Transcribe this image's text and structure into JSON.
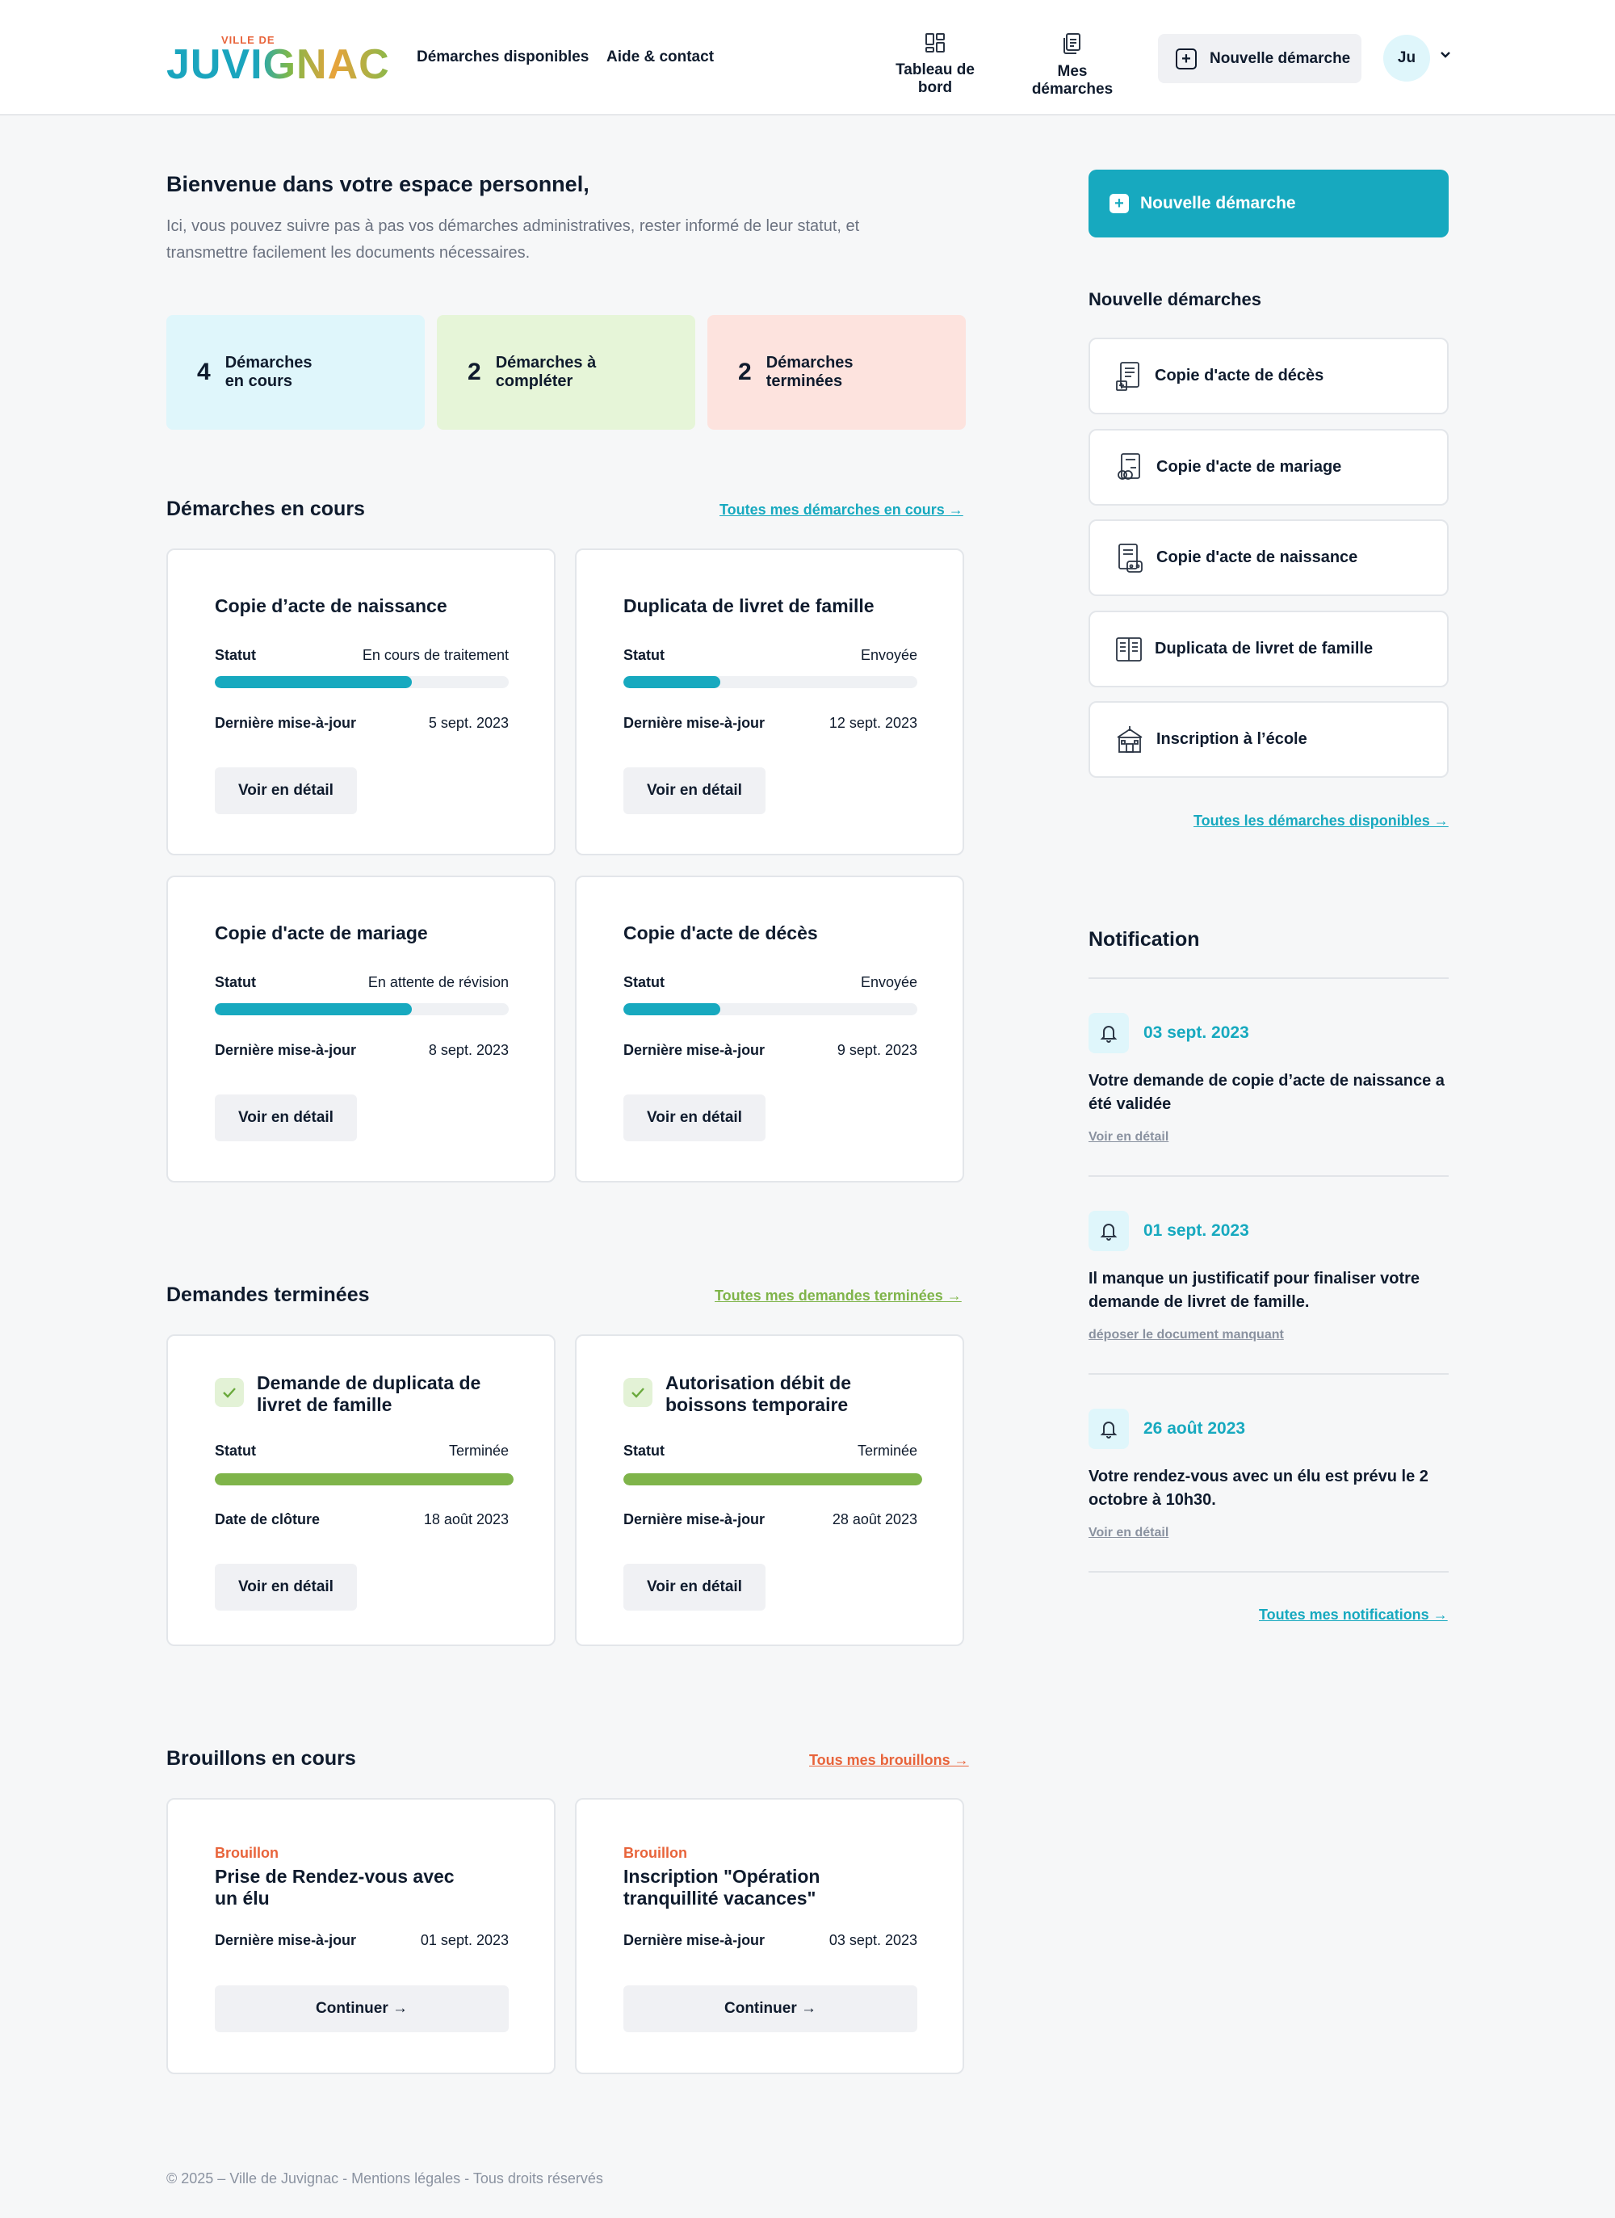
{
  "header": {
    "logo_small": "VILLE DE",
    "logo_big": "JUVIGNAC",
    "nav": [
      "Démarches disponibles",
      "Aide & contact"
    ],
    "dashboard_label": "Tableau de bord",
    "my_procedures_label": "Mes démarches",
    "new_procedure_label": "Nouvelle démarche",
    "avatar_initials": "Ju"
  },
  "welcome": {
    "title": "Bienvenue dans votre espace personnel,",
    "text": "Ici, vous pouvez suivre pas à pas vos démarches administratives, rester informé de leur statut, et transmettre facilement les documents nécessaires."
  },
  "stats": [
    {
      "value": "4",
      "label_line1": "Démarches",
      "label_line2": "en cours",
      "color": "#dff6fb"
    },
    {
      "value": "2",
      "label_line1": "Démarches à",
      "label_line2": "compléter",
      "color": "#e6f5d8"
    },
    {
      "value": "2",
      "label_line1": "Démarches",
      "label_line2": "terminées",
      "color": "#fde3de"
    }
  ],
  "in_progress": {
    "title": "Démarches en cours",
    "link": "Toutes mes démarches en cours →",
    "cards": [
      {
        "title": "Copie d’acte de naissance",
        "status_label": "Statut",
        "status": "En cours de traitement",
        "progress": 0.67,
        "date_label": "Dernière mise-à-jour",
        "date": "5 sept. 2023",
        "button": "Voir en détail"
      },
      {
        "title": "Duplicata de livret de famille",
        "status_label": "Statut",
        "status": "Envoyée",
        "progress": 0.33,
        "date_label": "Dernière mise-à-jour",
        "date": "12 sept. 2023",
        "button": "Voir en détail"
      },
      {
        "title": "Copie d'acte de mariage",
        "status_label": "Statut",
        "status": "En attente de révision",
        "progress": 0.67,
        "date_label": "Dernière mise-à-jour",
        "date": "8 sept. 2023",
        "button": "Voir en détail"
      },
      {
        "title": "Copie d'acte de décès",
        "status_label": "Statut",
        "status": "Envoyée",
        "progress": 0.33,
        "date_label": "Dernière mise-à-jour",
        "date": "9 sept. 2023",
        "button": "Voir en détail"
      }
    ]
  },
  "completed": {
    "title": "Demandes terminées",
    "link": "Toutes mes demandes terminées →",
    "cards": [
      {
        "title_line1": "Demande de duplicata de",
        "title_line2": "livret de famille",
        "status_label": "Statut",
        "status": "Terminée",
        "progress": 1.0,
        "date_label": "Date de clôture",
        "date": "18 août 2023",
        "button": "Voir en détail"
      },
      {
        "title_line1": "Autorisation débit de",
        "title_line2": "boissons temporaire",
        "status_label": "Statut",
        "status": "Terminée",
        "progress": 1.0,
        "date_label": "Dernière mise-à-jour",
        "date": "28 août 2023",
        "button": "Voir en détail"
      }
    ]
  },
  "drafts": {
    "title": "Brouillons en cours",
    "link": "Tous mes brouillons →",
    "cards": [
      {
        "tag": "Brouillon",
        "title_line1": "Prise de Rendez-vous avec",
        "title_line2": "un élu",
        "date_label": "Dernière mise-à-jour",
        "date": "01 sept. 2023",
        "button": "Continuer →"
      },
      {
        "tag": "Brouillon",
        "title_line1": "Inscription \"Opération",
        "title_line2": "tranquillité vacances\"",
        "date_label": "Dernière mise-à-jour",
        "date": "03 sept. 2023",
        "button": "Continuer →"
      }
    ]
  },
  "sidebar": {
    "new_button": "Nouvelle démarche",
    "subtitle": "Nouvelle démarches",
    "procedures": [
      {
        "label": "Copie d'acte de décès",
        "icon": "death-certificate-icon"
      },
      {
        "label": "Copie d'acte de mariage",
        "icon": "marriage-certificate-icon"
      },
      {
        "label": "Copie d'acte de naissance",
        "icon": "birth-certificate-icon"
      },
      {
        "label": "Duplicata de livret de famille",
        "icon": "family-book-icon"
      },
      {
        "label": "Inscription à l’école",
        "icon": "school-icon"
      }
    ],
    "all_link": "Toutes les démarches disponibles →",
    "notifications_title": "Notification",
    "notifications": [
      {
        "date": "03 sept. 2023",
        "text": "Votre demande de copie d’acte de naissance a été validée",
        "link": "Voir en détail"
      },
      {
        "date": "01 sept. 2023",
        "text": "Il manque un justificatif pour finaliser votre demande de livret de famille.",
        "link": "déposer le document manquant"
      },
      {
        "date": "26 août 2023",
        "text": "Votre rendez-vous avec un élu est prévu le 2 octobre à 10h30.",
        "link": "Voir en détail"
      }
    ],
    "all_notifications_link": "Toutes mes notifications →"
  },
  "colors": {
    "accent": "#17a9bf",
    "success": "#7fb44a",
    "draft": "#e8643b"
  },
  "footer": "© 2025 – Ville de Juvignac - Mentions légales - Tous droits réservés"
}
